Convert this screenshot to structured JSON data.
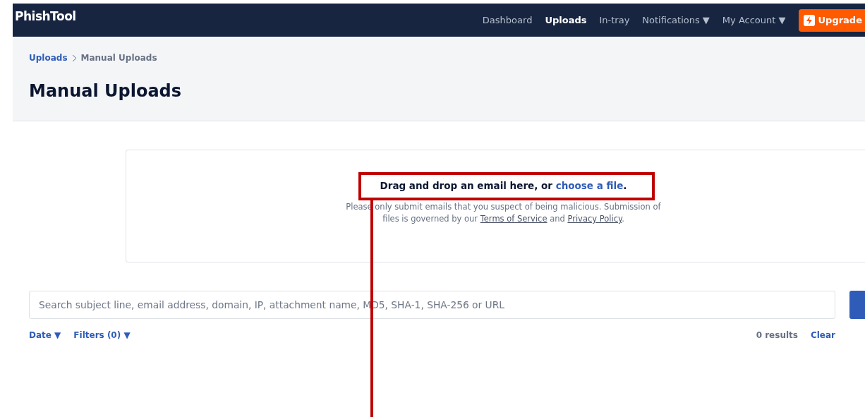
{
  "navbar": {
    "brand": "PhishTool",
    "items": [
      {
        "label": "Dashboard",
        "selected": false
      },
      {
        "label": "Uploads",
        "selected": true
      },
      {
        "label": "In-tray",
        "selected": false
      },
      {
        "label": "Notifications",
        "selected": false,
        "menu": "▼"
      },
      {
        "label": "My Account",
        "selected": false,
        "menu": "▼"
      }
    ],
    "upgrade": "Upgrade"
  },
  "breadcrumb": [
    {
      "label": "Uploads",
      "kind": "link"
    },
    {
      "label": "Manual Uploads",
      "kind": "current"
    }
  ],
  "page_title": "Manual Uploads",
  "dropzone": {
    "headline": [
      {
        "kind": "text",
        "text": "Drag and drop an email here, or "
      },
      {
        "kind": "link",
        "text": "choose a file"
      },
      {
        "kind": "text",
        "text": "."
      }
    ],
    "note": [
      {
        "kind": "text",
        "text": "Please only submit emails that you suspect of being malicious. Submission of files is governed by our "
      },
      {
        "kind": "link",
        "text": "Terms of Service"
      },
      {
        "kind": "text",
        "text": " and "
      },
      {
        "kind": "link",
        "text": "Privacy Policy"
      },
      {
        "kind": "text",
        "text": "."
      }
    ]
  },
  "search": {
    "placeholder": "Search subject line, email address, domain, IP, attachment name, MD5, SHA-1, SHA-256 or URL"
  },
  "filters": [
    {
      "label": "Date",
      "caret": "▼"
    },
    {
      "label": "Filters (0)",
      "caret": "▼"
    }
  ],
  "results": {
    "count": "0 results",
    "clear": "Clear"
  },
  "annotation": {
    "kind": "highlight"
  }
}
